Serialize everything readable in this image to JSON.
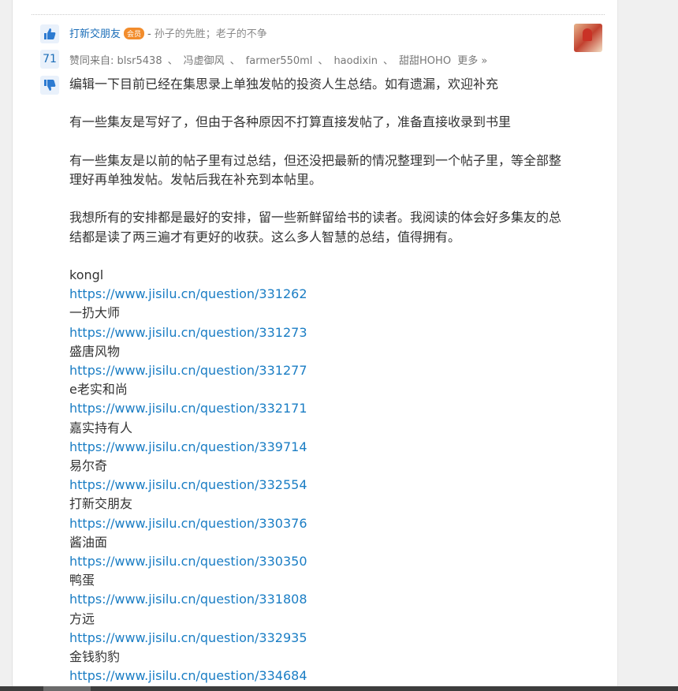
{
  "answer": {
    "user": "打新交朋友",
    "badge": "会员",
    "separator": "-",
    "signature": "孙子的先胜；老子的不争",
    "vote_count": "71",
    "likers_label": "赞同来自:",
    "likers": [
      "blsr5438",
      "冯虚御风",
      "farmer550ml",
      "haodixin",
      "甜甜HOHO"
    ],
    "likers_sep": "、",
    "more_link": "更多 »",
    "paragraphs": [
      "编辑一下目前已经在集思录上单独发帖的投资人生总结。如有遗漏，欢迎补充",
      "有一些集友是写好了，但由于各种原因不打算直接发帖了，准备直接收录到书里",
      "有一些集友是以前的帖子里有过总结，但还没把最新的情况整理到一个帖子里，等全部整理好再单独发帖。发帖后我在补充到本帖里。",
      "我想所有的安排都是最好的安排，留一些新鲜留给书的读者。我阅读的体会好多集友的总结都是读了两三遍才有更好的收获。这么多人智慧的总结，值得拥有。"
    ],
    "entries": [
      {
        "name": "kongl",
        "link": "https://www.jisilu.cn/question/331262"
      },
      {
        "name": "一扔大师",
        "link": "https://www.jisilu.cn/question/331273"
      },
      {
        "name": "盛唐风物",
        "link": "https://www.jisilu.cn/question/331277"
      },
      {
        "name": "e老实和尚",
        "link": "https://www.jisilu.cn/question/332171"
      },
      {
        "name": "嘉实持有人",
        "link": "https://www.jisilu.cn/question/339714"
      },
      {
        "name": "易尔奇",
        "link": "https://www.jisilu.cn/question/332554"
      },
      {
        "name": "打新交朋友",
        "link": "https://www.jisilu.cn/question/330376"
      },
      {
        "name": "酱油面",
        "link": "https://www.jisilu.cn/question/330350"
      },
      {
        "name": "鸭蛋",
        "link": "https://www.jisilu.cn/question/331808"
      },
      {
        "name": "方远",
        "link": "https://www.jisilu.cn/question/332935"
      },
      {
        "name": "金钱豹豹",
        "link": "https://www.jisilu.cn/question/334684"
      }
    ]
  },
  "colors": {
    "link": "#1a7dc4",
    "badge": "#f28c2c",
    "vote_bg": "#e9f1fb"
  }
}
